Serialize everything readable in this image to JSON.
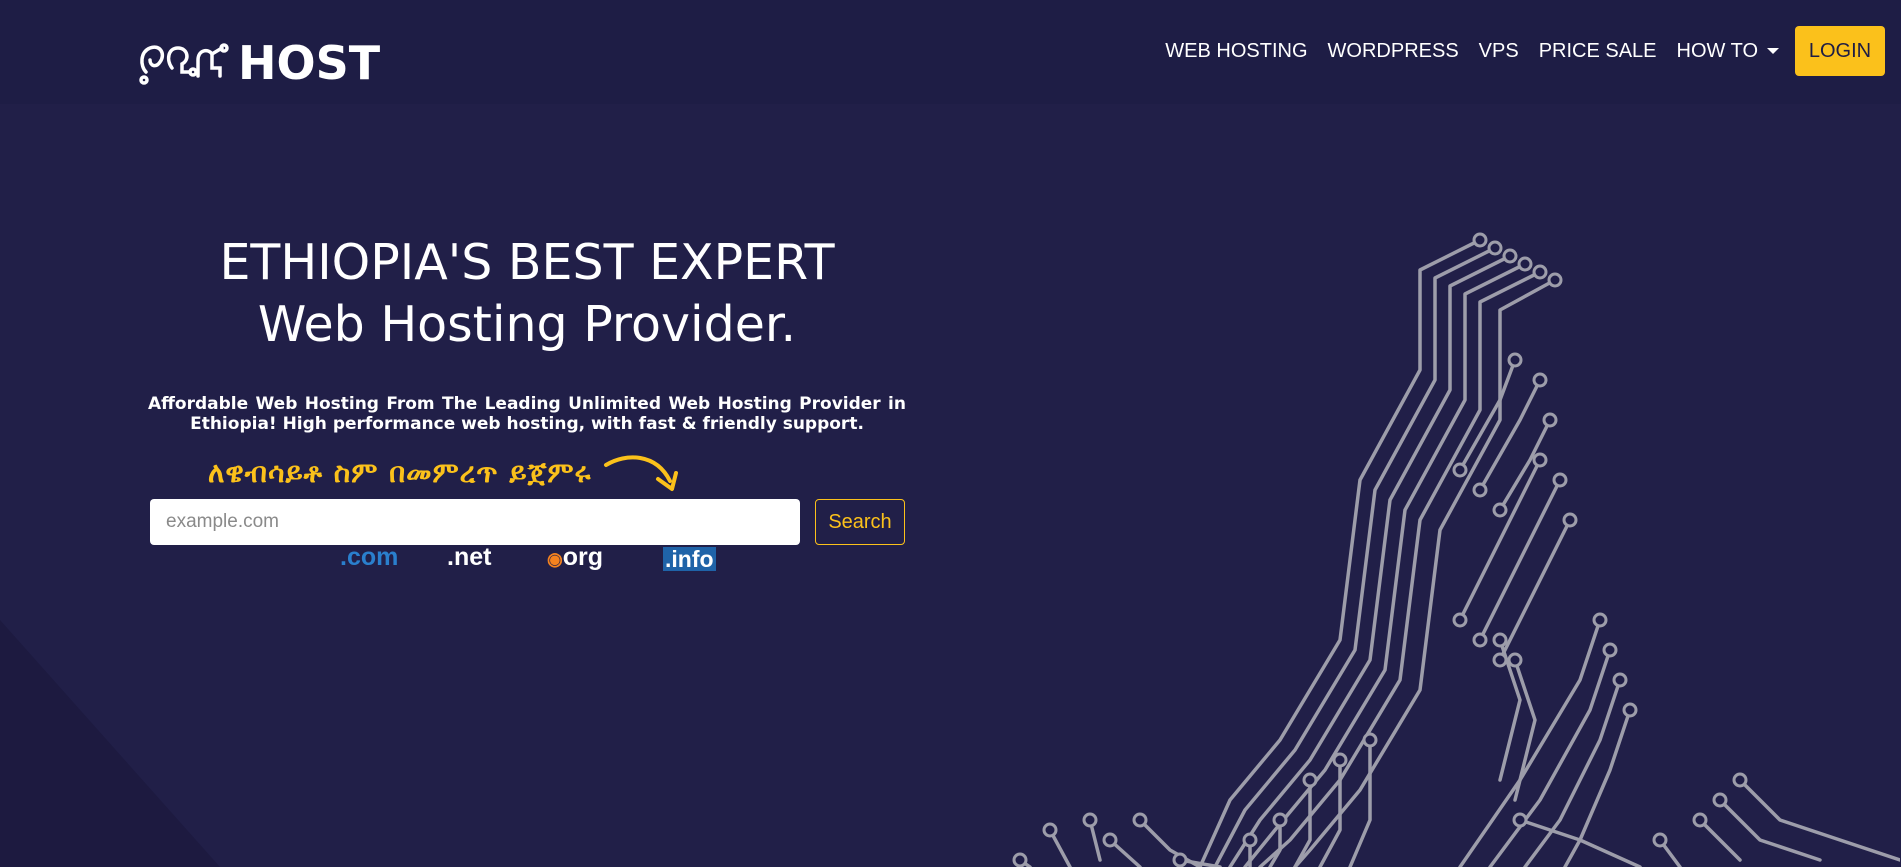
{
  "brand": {
    "logo_text": "HOST",
    "logo_mark_icon": "amharic-circuit-logo-icon"
  },
  "nav": {
    "items": [
      {
        "label": "WEB HOSTING"
      },
      {
        "label": "WORDPRESS"
      },
      {
        "label": "VPS"
      },
      {
        "label": "PRICE SALE"
      },
      {
        "label": "HOW TO",
        "has_dropdown": true
      }
    ],
    "login_label": "LOGIN"
  },
  "hero": {
    "title_line1": "ETHIOPIA'S BEST EXPERT",
    "title_line2": "Web Hosting Provider.",
    "subtitle": "Affordable Web Hosting From The Leading Unlimited Web Hosting Provider in Ethiopia! High performance web hosting, with fast & friendly support.",
    "amharic_prompt": "ለዌብሳይቶ ስም በመምረጥ ይጀምሩ"
  },
  "search": {
    "placeholder": "example.com",
    "value": "",
    "button_label": "Search"
  },
  "tlds": [
    {
      "label": ".com"
    },
    {
      "label": ".net"
    },
    {
      "label": "org"
    },
    {
      "label": ".info"
    }
  ],
  "colors": {
    "background": "#211f48",
    "navbar": "#1e1d45",
    "accent": "#fbc11b",
    "circuit": "#9a9aa8"
  }
}
